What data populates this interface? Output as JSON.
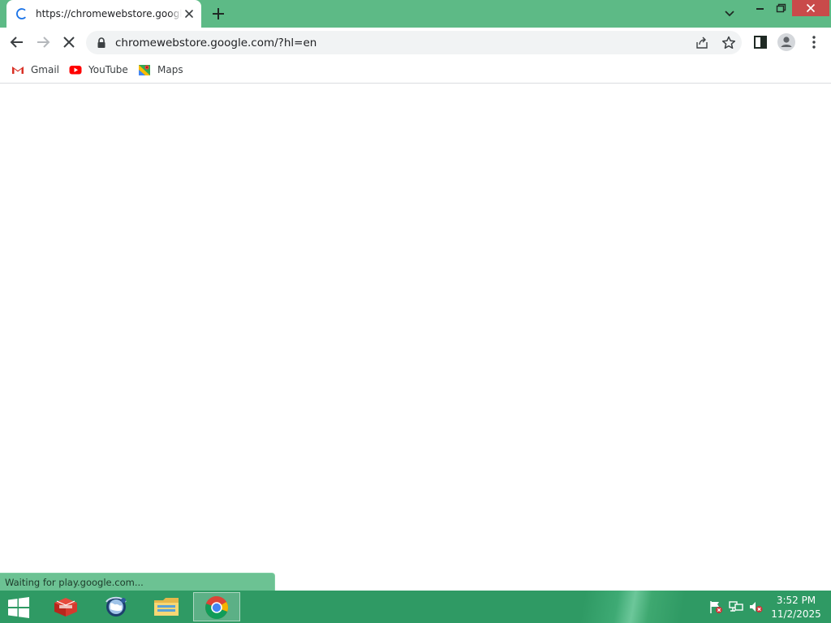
{
  "browser": {
    "tab": {
      "title": "https://chromewebstore.google.com/?hl=en",
      "state": "loading"
    },
    "omnibox": {
      "url": "chromewebstore.google.com/?hl=en"
    },
    "bookmarks": [
      {
        "label": "Gmail",
        "icon": "gmail-icon"
      },
      {
        "label": "YouTube",
        "icon": "youtube-icon"
      },
      {
        "label": "Maps",
        "icon": "maps-icon"
      }
    ],
    "status_text": "Waiting for play.google.com..."
  },
  "taskbar": {
    "apps": [
      {
        "name": "toolbox-app",
        "icon": "red-box-icon"
      },
      {
        "name": "globe-app",
        "icon": "globe-icon"
      },
      {
        "name": "file-explorer",
        "icon": "folder-icon"
      },
      {
        "name": "chrome",
        "icon": "chrome-icon",
        "active": true
      }
    ],
    "clock": {
      "time": "3:52 PM",
      "date": "11/2/2025"
    }
  },
  "colors": {
    "titlebar": "#5dba86",
    "taskbar": "#2f9a64",
    "close_button": "#c94a4a",
    "status_bubble": "#6cc293"
  }
}
